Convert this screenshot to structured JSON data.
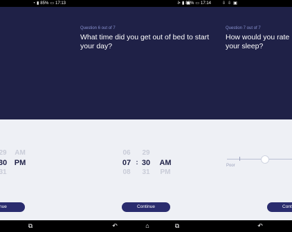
{
  "screens": {
    "left": {
      "status": {
        "time": "17:13",
        "battery": "85%"
      },
      "picker": {
        "minutes": [
          "29",
          "30",
          "31"
        ],
        "ampm": [
          "AM",
          "PM"
        ]
      },
      "continue_label": "ntinue"
    },
    "middle": {
      "status": {
        "time": "17:14",
        "battery": "85%"
      },
      "question_counter": "Question 6 out of 7",
      "question_text": "What time did you get out of bed to start your day?",
      "picker": {
        "hours": [
          "06",
          "07",
          "08"
        ],
        "separator": ":",
        "minutes": [
          "29",
          "30",
          "31"
        ],
        "ampm": [
          "AM",
          "PM"
        ]
      },
      "continue_label": "Continue"
    },
    "right": {
      "question_counter": "Question 7 out of 7",
      "question_text": "How would you rate your sleep?",
      "slider": {
        "min_label": "Poor",
        "value_fraction": 0.55
      },
      "continue_label": "Cont"
    }
  },
  "icons": {
    "nav": [
      "back-icon",
      "home-icon",
      "recent-apps-icon"
    ],
    "status": [
      "wifi-icon",
      "sim-icon",
      "battery-icon",
      "download-icon",
      "image-icon"
    ]
  },
  "colors": {
    "header": "#1f2147",
    "accent": "#2a2c6e",
    "background": "#eef0f5"
  }
}
